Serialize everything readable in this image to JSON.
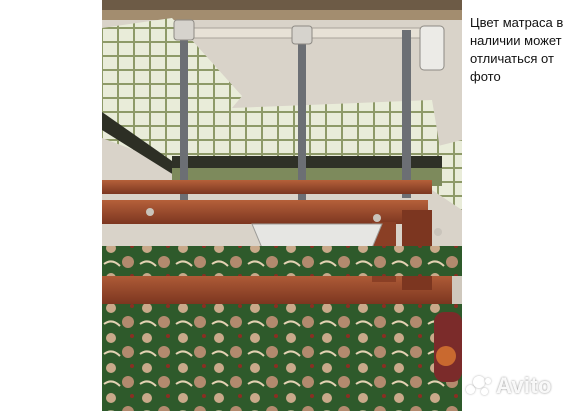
{
  "caption": {
    "lines": [
      "Цвет матраса в",
      "наличии может",
      "отличаться от",
      "фото"
    ]
  },
  "watermark": {
    "brand": "Avito"
  },
  "colors": {
    "wood_frame": "#9a4a2c",
    "mattress": "#7d8a5c",
    "carpet": "#2f5a2a",
    "wall": "#d8d2c8"
  }
}
